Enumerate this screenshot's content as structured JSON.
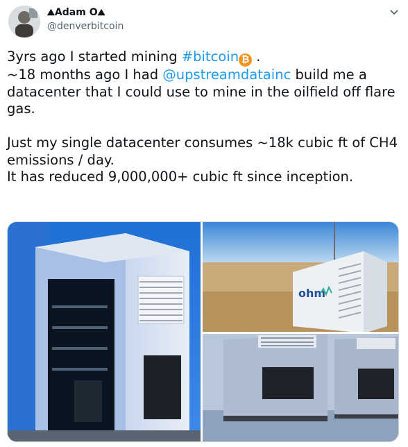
{
  "user": {
    "display_name": "Adam O",
    "name_prefix_glyph": "⛰",
    "name_suffix_glyph": "⛰",
    "handle": "@denverbitcoin"
  },
  "menu": {
    "icon": "chevron-down-icon"
  },
  "tweet": {
    "line1_a": "3yrs ago I started mining ",
    "hashtag": "#bitcoin",
    "bitcoin_emoji": "₿",
    "line1_b": " .",
    "line2_a": "~18 months ago I had ",
    "mention": "@upstreamdatainc",
    "line2_b": " build me a datacenter that I could use to mine in the oilfield off flare gas.",
    "line3": "Just my single datacenter consumes ~18k cubic ft of CH4 emissions / day.",
    "line4": "It has reduced 9,000,000+ cubic ft since inception."
  },
  "media": {
    "tr_logo_text": "ohm"
  }
}
